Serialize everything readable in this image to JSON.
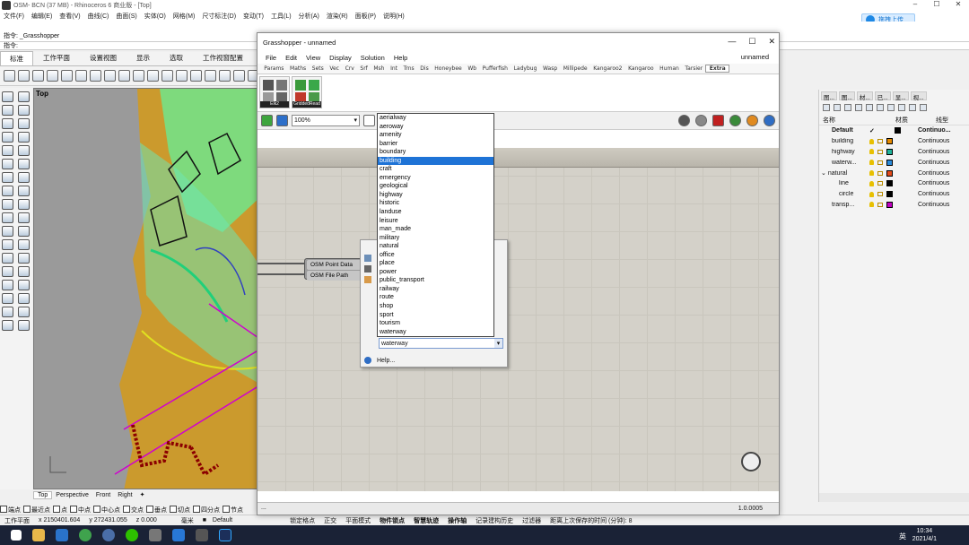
{
  "rhino": {
    "title": "OSM- BCN (37 MB) - Rhinoceros 6 商业版 - [Top]",
    "menu": [
      "文件(F)",
      "编辑(E)",
      "查看(V)",
      "曲线(C)",
      "曲面(S)",
      "实体(O)",
      "网格(M)",
      "尺寸标注(D)",
      "变动(T)",
      "工具(L)",
      "分析(A)",
      "渲染(R)",
      "面板(P)",
      "说明(H)"
    ],
    "command_history": "指令: _Grasshopper",
    "command_prompt": "指令:",
    "tabs": [
      "标准",
      "工作平面",
      "设置视图",
      "显示",
      "选取",
      "工作视窗配置"
    ],
    "viewport_label": "Top",
    "viewport_tabs": [
      "Top",
      "Perspective",
      "Front",
      "Right"
    ],
    "osnaps": [
      "端点",
      "最近点",
      "点",
      "中点",
      "中心点",
      "交点",
      "垂点",
      "切点",
      "四分点",
      "节点"
    ],
    "status": {
      "plane": "工作平面",
      "x": "x 2150401.604",
      "y": "y 272431.055",
      "z": "z 0.000",
      "unit": "毫米",
      "layer": "Default",
      "items": [
        "锁定格点",
        "正交",
        "平面模式",
        "物件锁点",
        "智慧轨迹",
        "操作轴",
        "记录建构历史",
        "过滤器",
        "距离上次保存的时间 (分钟): 8"
      ]
    },
    "upload_button": "拖拽上传"
  },
  "layers_panel": {
    "tab_labels": [
      "图...",
      "图...",
      "材...",
      "已...",
      "显...",
      "视..."
    ],
    "headers": {
      "name": "名称",
      "material": "材质",
      "linetype": "线型"
    },
    "layers": [
      {
        "name": "Default",
        "linetype": "Continuo...",
        "color": "#000000",
        "bold": true,
        "indent": 1
      },
      {
        "name": "building",
        "linetype": "Continuous",
        "color": "#e58a00",
        "indent": 0
      },
      {
        "name": "highway",
        "linetype": "Continuous",
        "color": "#1fb39a",
        "indent": 0
      },
      {
        "name": "waterw...",
        "linetype": "Continuous",
        "color": "#2b8bd9",
        "indent": 0
      },
      {
        "name": "natural",
        "linetype": "Continuous",
        "color": "#e34b1a",
        "indent": 0
      },
      {
        "name": "line",
        "linetype": "Continuous",
        "color": "#000000",
        "indent": 2
      },
      {
        "name": "circle",
        "linetype": "Continuous",
        "color": "#000000",
        "indent": 2
      },
      {
        "name": "transp...",
        "linetype": "Continuous",
        "color": "#c000c0",
        "indent": 0
      }
    ]
  },
  "grasshopper": {
    "title": "Grasshopper - unnamed",
    "doc_name": "unnamed",
    "menu": [
      "File",
      "Edit",
      "View",
      "Display",
      "Solution",
      "Help"
    ],
    "tabs": [
      "Params",
      "Maths",
      "Sets",
      "Vec",
      "Crv",
      "Srf",
      "Msh",
      "Int",
      "Trns",
      "Dis",
      "Honeybee",
      "Wb",
      "Pufferfish",
      "Ladybug",
      "Wasp",
      "Millipede",
      "Kangaroo2",
      "Kangaroo",
      "Human",
      "Tarsier",
      "Extra"
    ],
    "active_tab": "Extra",
    "ribbon_groups": [
      "Elk2",
      "GriddedRead"
    ],
    "zoom": "100%",
    "component": {
      "inputs": [
        "OSM Point Data",
        "OSM File Path"
      ]
    },
    "dropdown_options": [
      "aerialway",
      "aeroway",
      "amenity",
      "barrier",
      "boundary",
      "building",
      "craft",
      "emergency",
      "geological",
      "highway",
      "historic",
      "landuse",
      "leisure",
      "man_made",
      "military",
      "natural",
      "office",
      "place",
      "power",
      "public_transport",
      "railway",
      "route",
      "shop",
      "sport",
      "tourism",
      "waterway"
    ],
    "selected_option": "building",
    "select_value": "waterway",
    "help_label": "Help...",
    "status_left": "...",
    "status_right": "1.0.0005"
  },
  "taskbar": {
    "time": "10:34",
    "date": "2021/4/1",
    "lang": "英"
  }
}
